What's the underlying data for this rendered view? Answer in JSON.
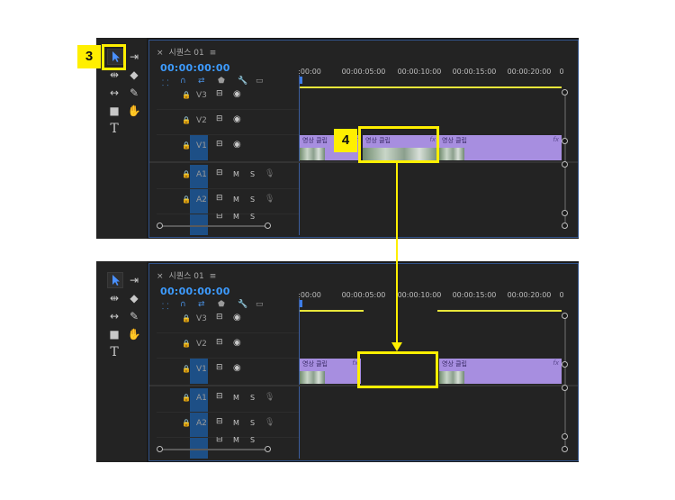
{
  "annotations": {
    "step3": "3",
    "step4": "4"
  },
  "panel": {
    "tab_close": "×",
    "sequence_name": "시퀀스 01",
    "tab_menu": "≡",
    "timecode": "00:00:00:00",
    "ruler_labels": [
      ":00:00",
      "00:00:05:00",
      "00:00:10:00",
      "00:00:15:00",
      "00:00:20:00",
      "0"
    ],
    "tracks": {
      "V3": "V3",
      "V2": "V2",
      "V1": "V1",
      "A1": "A1",
      "A2": "A2",
      "mute": "M",
      "solo": "S"
    }
  },
  "clips_top": [
    {
      "label": "영상 클립",
      "fx": "fx"
    },
    {
      "label": "영상 클립",
      "fx": "fx"
    },
    {
      "label": "영상 클립",
      "fx": "fx"
    }
  ],
  "clips_bottom": [
    {
      "label": "영상 클립",
      "fx": "fx"
    },
    {
      "label": "영상 클립",
      "fx": "fx"
    }
  ],
  "colors": {
    "accent_highlight": "#ffef00",
    "timecode_blue": "#3d9bff",
    "clip_purple": "#a78ee0",
    "track_target_blue": "#1d4f86"
  },
  "tools": [
    "selection-tool",
    "track-select-tool",
    "ripple-edit-tool",
    "razor-tool",
    "slip-tool",
    "pen-tool",
    "rectangle-tool",
    "hand-tool",
    "type-tool"
  ]
}
